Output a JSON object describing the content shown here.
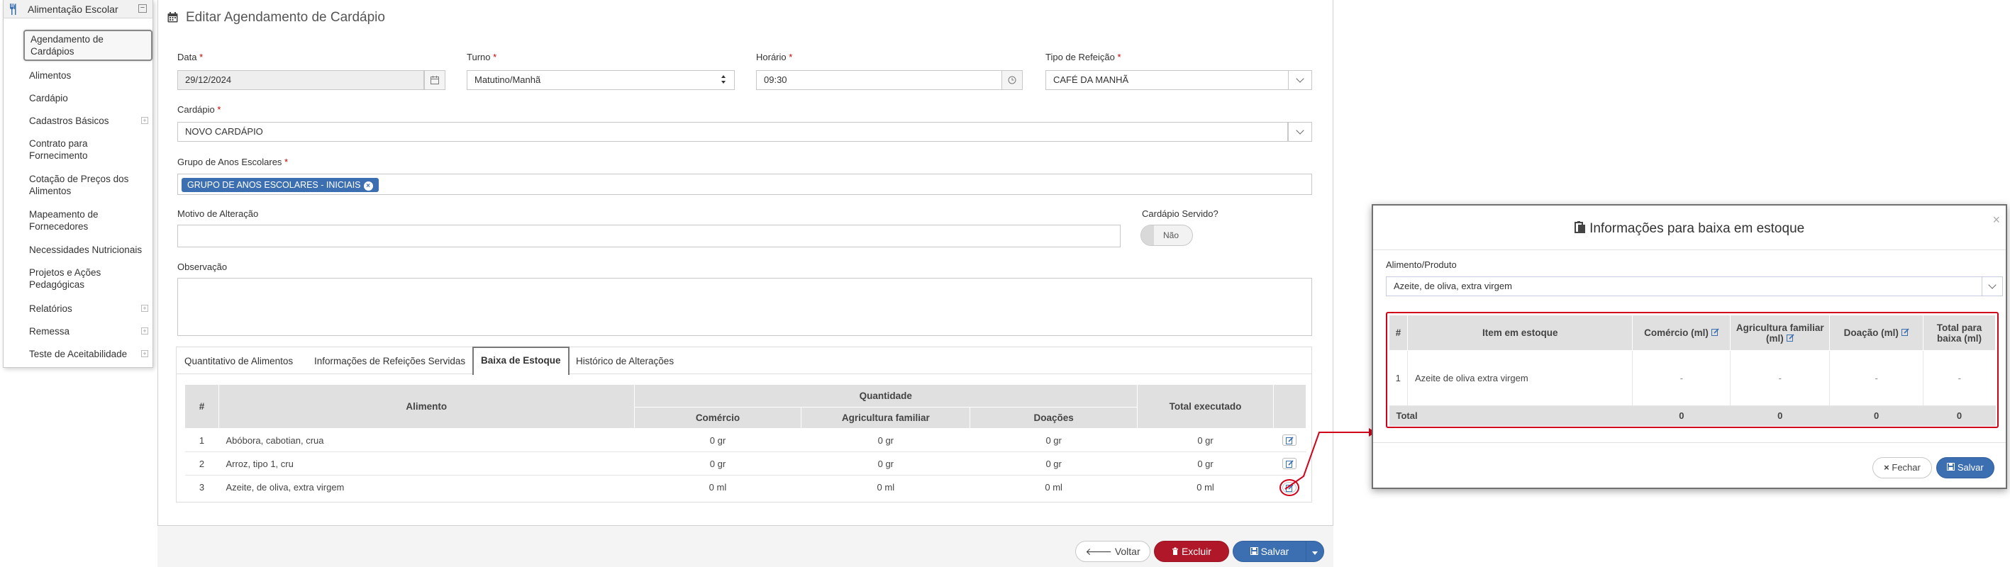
{
  "sidebar": {
    "title": "Alimentação Escolar",
    "items": [
      {
        "label": "Agendamento de Cardápios"
      },
      {
        "label": "Alimentos"
      },
      {
        "label": "Cardápio"
      },
      {
        "label": "Cadastros Básicos"
      },
      {
        "label": "Contrato para Fornecimento"
      },
      {
        "label": "Cotação de Preços dos Alimentos"
      },
      {
        "label": "Mapeamento de Fornecedores"
      },
      {
        "label": "Necessidades Nutricionais"
      },
      {
        "label": "Projetos e Ações Pedagógicas"
      },
      {
        "label": "Relatórios"
      },
      {
        "label": "Remessa"
      },
      {
        "label": "Teste de Aceitabilidade"
      }
    ]
  },
  "page": {
    "title": "Editar Agendamento de Cardápio"
  },
  "form": {
    "data": {
      "label": "Data",
      "value": "29/12/2024"
    },
    "turno": {
      "label": "Turno",
      "value": "Matutino/Manhã"
    },
    "horario": {
      "label": "Horário",
      "value": "09:30"
    },
    "tipo": {
      "label": "Tipo de Refeição",
      "value": "CAFÉ DA MANHÃ"
    },
    "cardapio": {
      "label": "Cardápio",
      "value": "NOVO CARDÁPIO"
    },
    "grupo": {
      "label": "Grupo de Anos Escolares",
      "tag": "GRUPO DE ANOS ESCOLARES - INICIAIS"
    },
    "motivo": {
      "label": "Motivo de Alteração",
      "value": ""
    },
    "servido": {
      "label": "Cardápio Servido?",
      "value": "Não"
    },
    "observacao": {
      "label": "Observação",
      "value": ""
    },
    "required_mark": "*"
  },
  "tabs": [
    "Quantitativo de Alimentos",
    "Informações de Refeições Servidas",
    "Baixa de Estoque",
    "Histórico de Alterações"
  ],
  "main_table": {
    "headers": {
      "num": "#",
      "alimento": "Alimento",
      "quantidade": "Quantidade",
      "comercio": "Comércio",
      "agricultura": "Agricultura familiar",
      "doacoes": "Doações",
      "total": "Total executado"
    },
    "rows": [
      {
        "n": "1",
        "alimento": "Abóbora, cabotian, crua",
        "comercio": "0 gr",
        "agricultura": "0 gr",
        "doacoes": "0 gr",
        "total": "0 gr"
      },
      {
        "n": "2",
        "alimento": "Arroz, tipo 1, cru",
        "comercio": "0 gr",
        "agricultura": "0 gr",
        "doacoes": "0 gr",
        "total": "0 gr"
      },
      {
        "n": "3",
        "alimento": "Azeite, de oliva, extra virgem",
        "comercio": "0 ml",
        "agricultura": "0 ml",
        "doacoes": "0 ml",
        "total": "0 ml"
      }
    ]
  },
  "footer": {
    "voltar": "Voltar",
    "excluir": "Excluir",
    "salvar": "Salvar"
  },
  "modal": {
    "title": "Informações para baixa em estoque",
    "field_label": "Alimento/Produto",
    "field_value": "Azeite, de oliva, extra virgem",
    "table": {
      "headers": {
        "num": "#",
        "item": "Item em estoque",
        "comercio": "Comércio (ml)",
        "agricultura": "Agricultura familiar (ml)",
        "doacao": "Doação (ml)",
        "total": "Total para baixa (ml)"
      },
      "rows": [
        {
          "n": "1",
          "item": "Azeite de oliva extra virgem",
          "comercio": "-",
          "agricultura": "-",
          "doacao": "-",
          "total": "-"
        }
      ],
      "total_row": {
        "label": "Total",
        "comercio": "0",
        "agricultura": "0",
        "doacao": "0",
        "total": "0"
      }
    },
    "fechar": "Fechar",
    "salvar": "Salvar",
    "close": "×"
  },
  "colors": {
    "primary": "#3c6fb1",
    "danger": "#b0182a",
    "annotation": "#d0021b"
  }
}
